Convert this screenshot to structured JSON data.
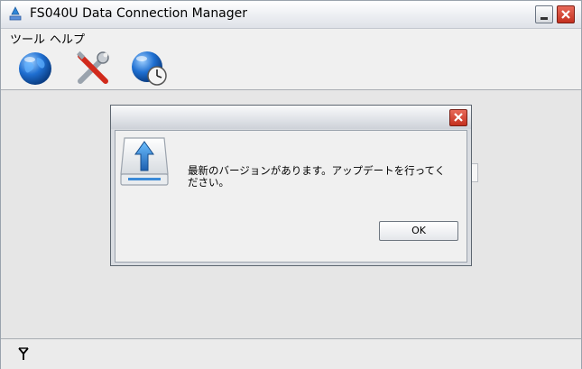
{
  "window": {
    "title": "FS040U Data Connection Manager"
  },
  "menu": {
    "items": [
      "ツール",
      "ヘルプ"
    ]
  },
  "toolbar": {
    "buttons": [
      {
        "icon": "globe-icon"
      },
      {
        "icon": "tools-icon"
      },
      {
        "icon": "globe-clock-icon"
      }
    ]
  },
  "dialog": {
    "message_line1": "最新のバージョンがあります。アップデートを行ってく",
    "message_line2": "ださい。",
    "ok_label": "OK"
  },
  "colors": {
    "close_button": "#d44130",
    "globe_blue": "#1f6fd1",
    "upload_arrow": "#2f86d6"
  }
}
